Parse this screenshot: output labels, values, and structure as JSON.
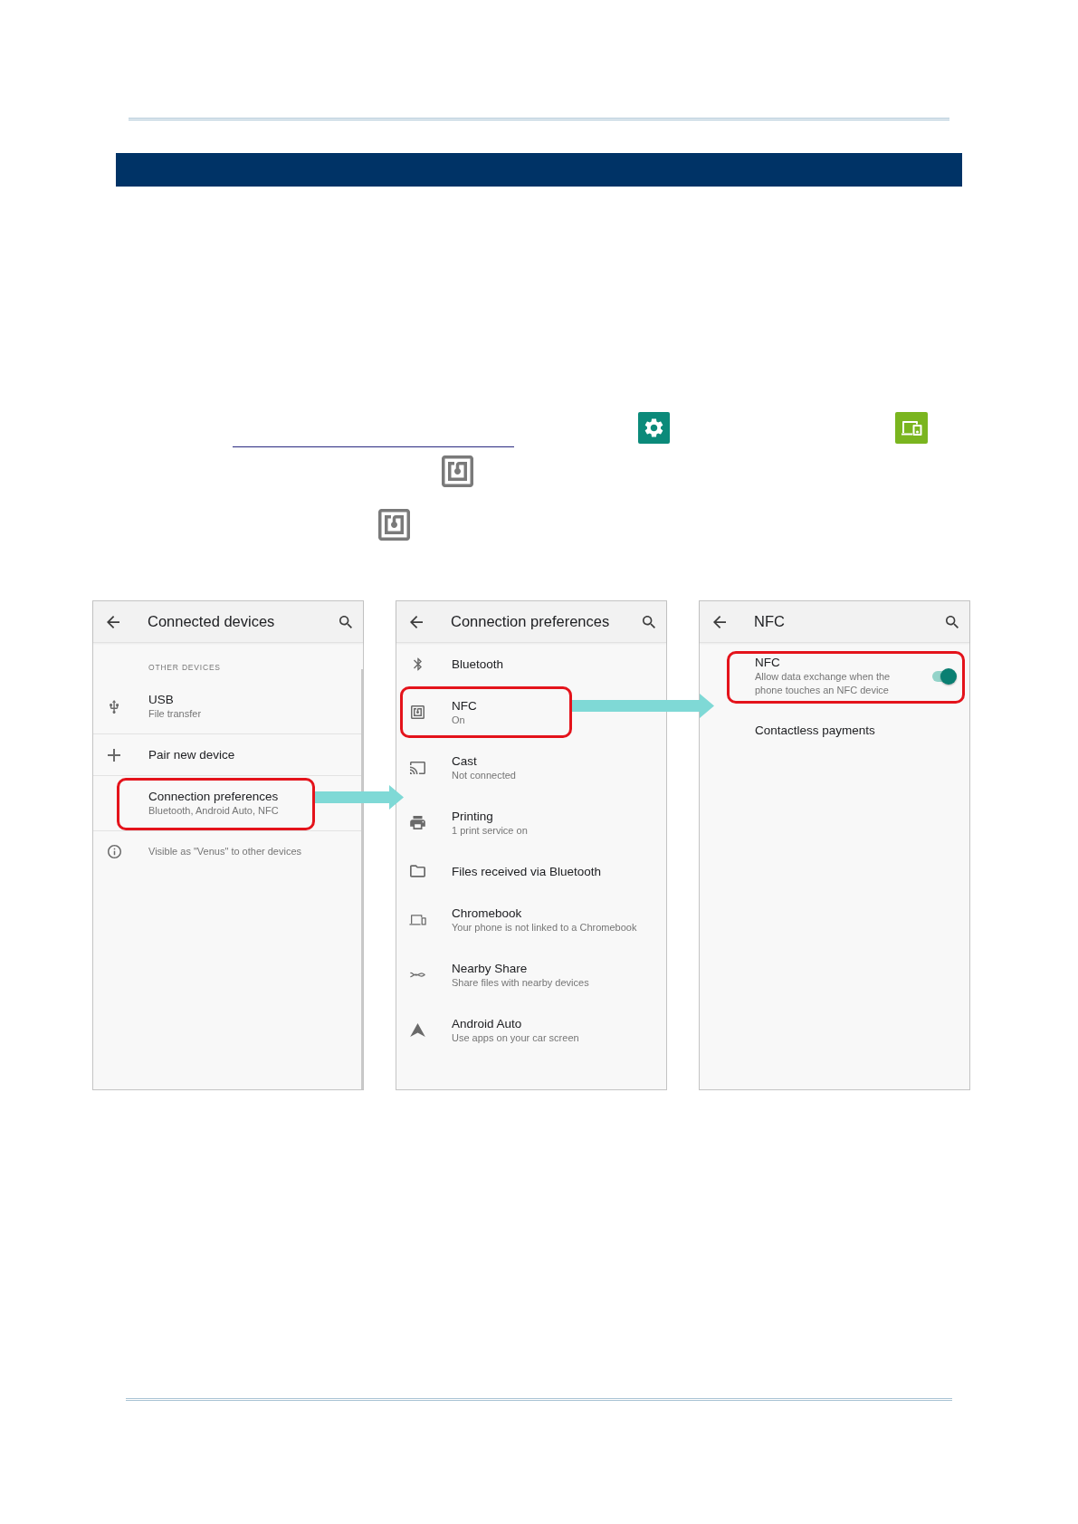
{
  "screens": [
    {
      "title": "Connected devices",
      "dividers": true,
      "items": [
        {
          "kind": "section",
          "label": "OTHER DEVICES",
          "highlighted": false
        },
        {
          "kind": "entry",
          "label": "USB",
          "summary": "File transfer",
          "highlighted": false
        },
        {
          "kind": "entry",
          "label": "Pair new device",
          "highlighted": false
        },
        {
          "kind": "entry",
          "label": "Connection preferences",
          "summary": "Bluetooth, Android Auto, NFC",
          "highlighted": true
        },
        {
          "kind": "footer",
          "label": "Visible as \"Venus\" to other devices",
          "highlighted": false
        }
      ]
    },
    {
      "title": "Connection preferences",
      "dividers": false,
      "items": [
        {
          "kind": "entry",
          "label": "Bluetooth",
          "highlighted": false
        },
        {
          "kind": "entry",
          "label": "NFC",
          "summary": "On",
          "highlighted": true
        },
        {
          "kind": "entry",
          "label": "Cast",
          "summary": "Not connected",
          "highlighted": false
        },
        {
          "kind": "entry",
          "label": "Printing",
          "summary": "1 print service on",
          "highlighted": false
        },
        {
          "kind": "entry",
          "label": "Files received via Bluetooth",
          "highlighted": false
        },
        {
          "kind": "entry",
          "label": "Chromebook",
          "summary": "Your phone is not linked to a Chromebook",
          "highlighted": false
        },
        {
          "kind": "entry",
          "label": "Nearby Share",
          "summary": "Share files with nearby devices",
          "highlighted": false
        },
        {
          "kind": "entry",
          "label": "Android Auto",
          "summary": "Use apps on your car screen",
          "highlighted": false
        }
      ]
    },
    {
      "title": "NFC",
      "dividers": false,
      "items": [
        {
          "kind": "toggle",
          "label": "NFC",
          "summary": "Allow data exchange when the phone touches an NFC device",
          "on": true,
          "highlighted": true
        },
        {
          "kind": "entry",
          "label": "Contactless payments",
          "highlighted": false
        }
      ]
    }
  ]
}
